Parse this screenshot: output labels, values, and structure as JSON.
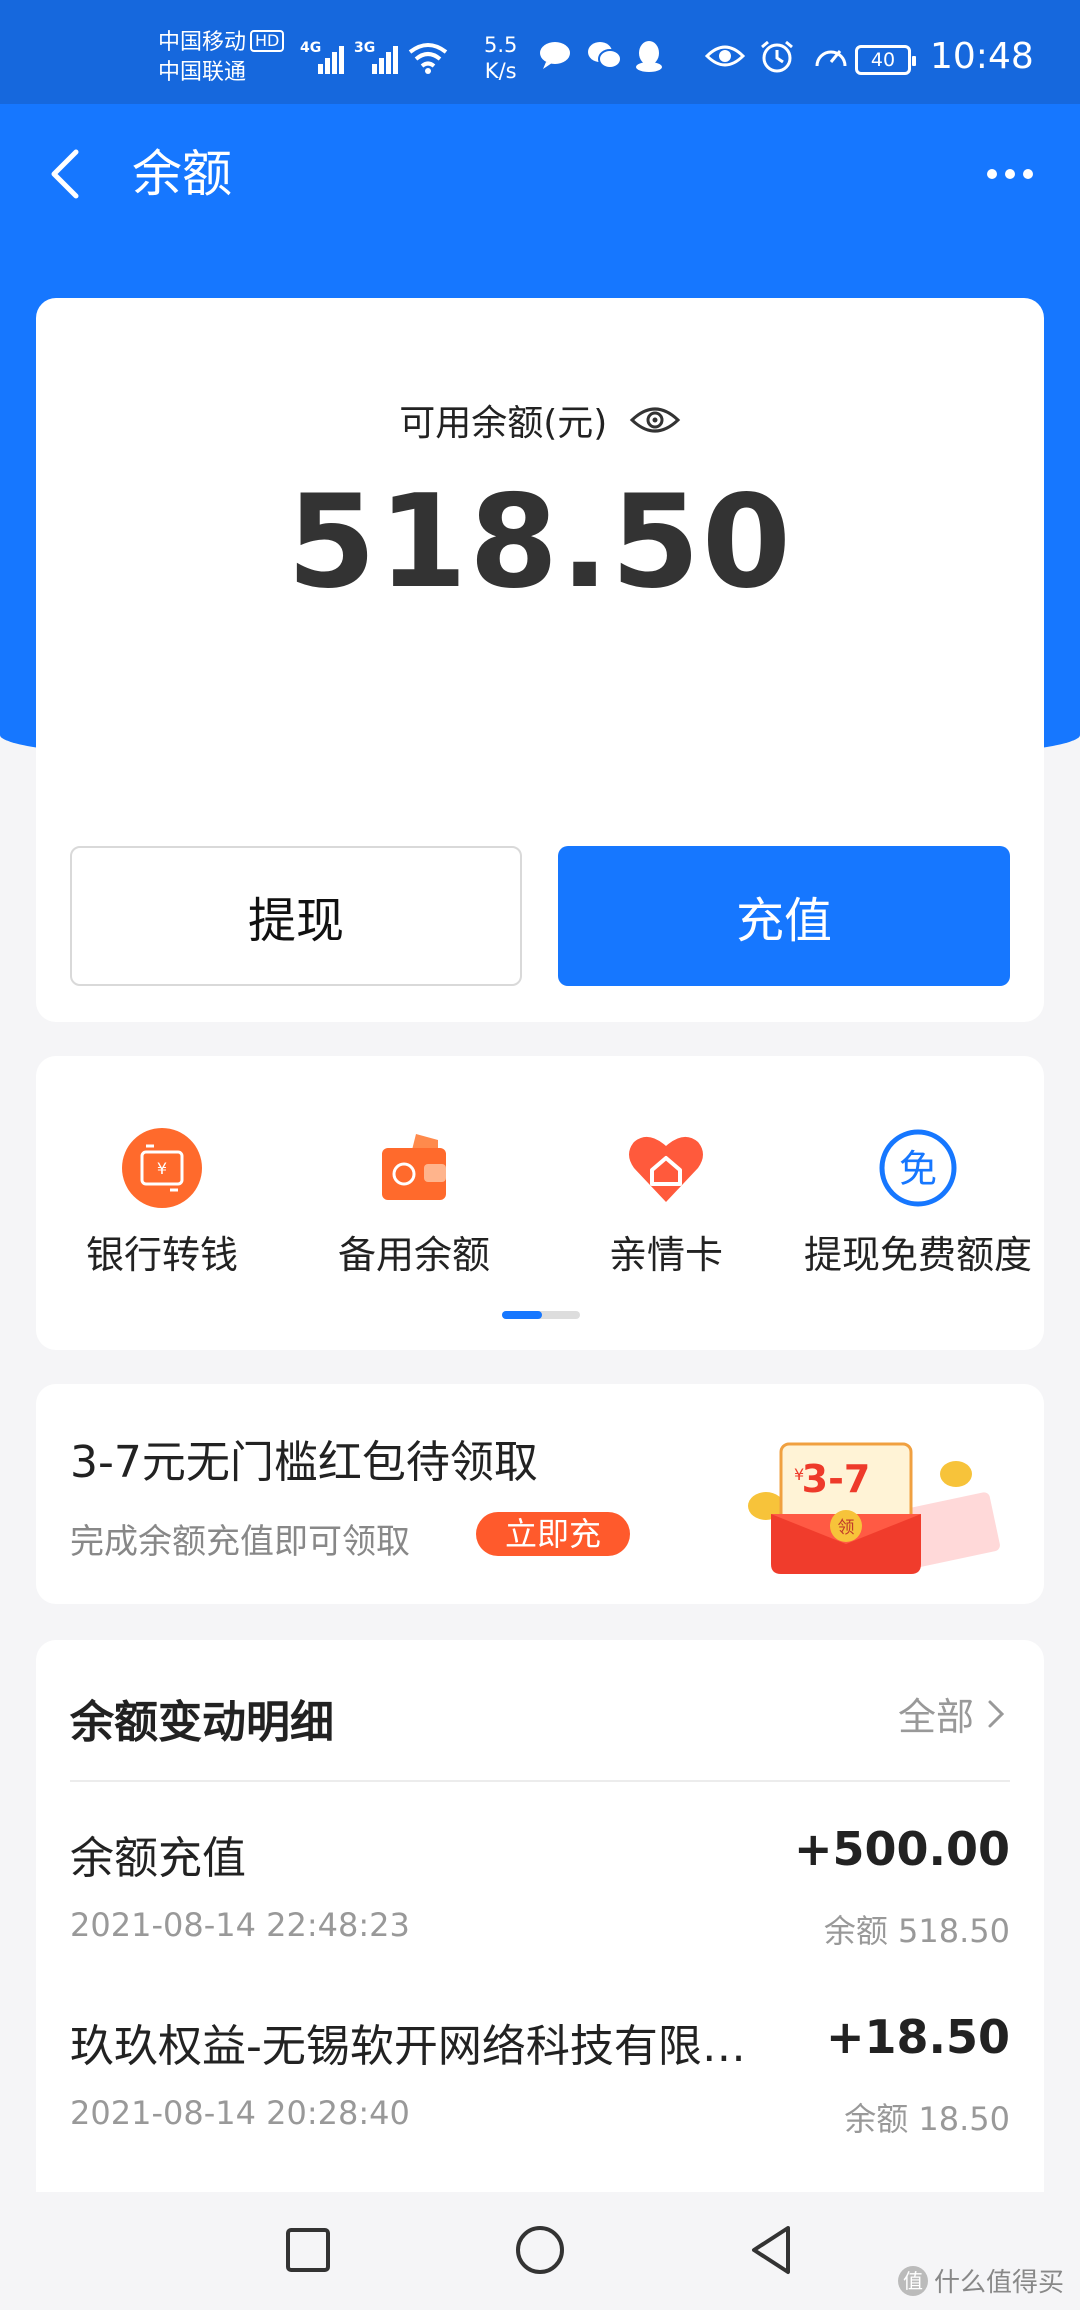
{
  "status_bar": {
    "carrier1": "中国移动",
    "carrier1_badge": "HD",
    "carrier2": "中国联通",
    "sig1_type": "4G",
    "sig2_type": "3G",
    "net_speed_value": "5.5",
    "net_speed_unit": "K/s",
    "battery": "40",
    "time": "10:48"
  },
  "header": {
    "title": "余额"
  },
  "balance": {
    "label": "可用余额(元)",
    "amount": "518.50",
    "withdraw_label": "提现",
    "recharge_label": "充值"
  },
  "services": {
    "items": [
      {
        "label": "银行转钱",
        "icon": "bank-transfer-icon"
      },
      {
        "label": "备用余额",
        "icon": "wallet-icon"
      },
      {
        "label": "亲情卡",
        "icon": "family-card-icon"
      },
      {
        "label": "提现免费额度",
        "icon": "free-quota-icon"
      }
    ],
    "free_icon_char": "免",
    "page": 1,
    "pages": 2
  },
  "promo": {
    "title": "3-7元无门槛红包待领取",
    "subtitle": "完成余额充值即可领取",
    "button": "立即充",
    "image_text": "3-7",
    "image_currency": "¥",
    "image_badge": "领"
  },
  "transactions": {
    "header": "余额变动明细",
    "all_label": "全部",
    "items": [
      {
        "name": "余额充值",
        "amount": "+500.00",
        "time": "2021-08-14 22:48:23",
        "balance": "余额 518.50"
      },
      {
        "name": "玖玖权益-无锡软开网络科技有限…",
        "amount": "+18.50",
        "time": "2021-08-14 20:28:40",
        "balance": "余额 18.50"
      }
    ]
  },
  "watermark": {
    "badge": "值",
    "text": "什么值得买"
  },
  "colors": {
    "accent": "#1677ff",
    "status_bar": "#1668dd",
    "promo_button": "#ff5a2c"
  }
}
